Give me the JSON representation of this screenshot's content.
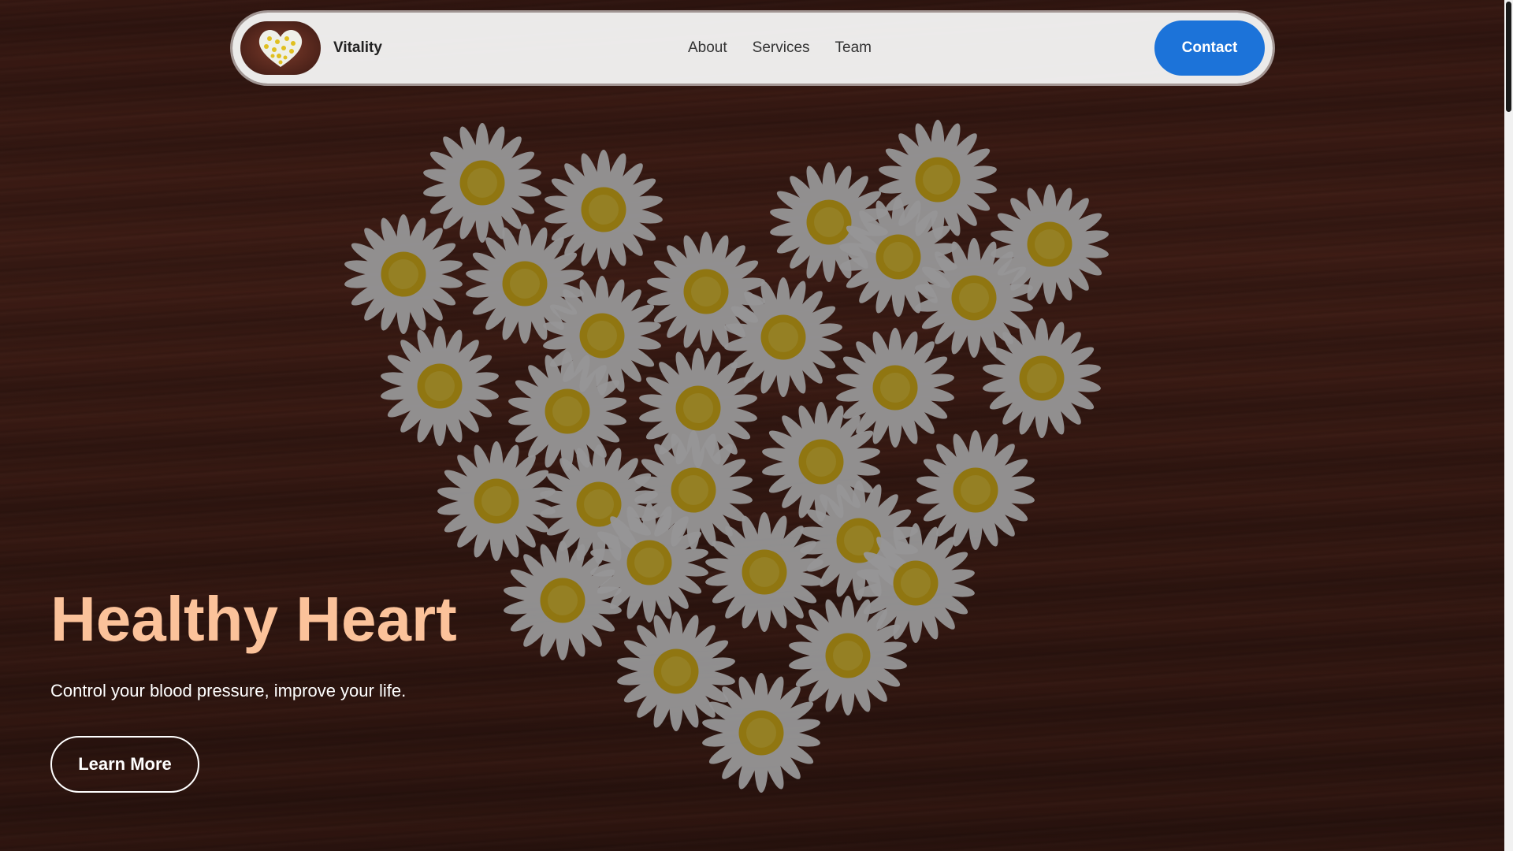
{
  "navbar": {
    "brand": "Vitality",
    "logo_icon": "daisy-heart-logo",
    "links": [
      {
        "label": "About"
      },
      {
        "label": "Services"
      },
      {
        "label": "Team"
      }
    ],
    "contact_label": "Contact"
  },
  "hero": {
    "background_image": "daisy-heart-on-wood",
    "title": "Healthy Heart",
    "subtitle": "Control your blood pressure, improve your life.",
    "cta_label": "Learn More"
  },
  "colors": {
    "accent": "#1c73d9",
    "title": "#fbc29a",
    "navbar_bg": "#f5f5f5",
    "wood_dark": "#4b2219"
  }
}
